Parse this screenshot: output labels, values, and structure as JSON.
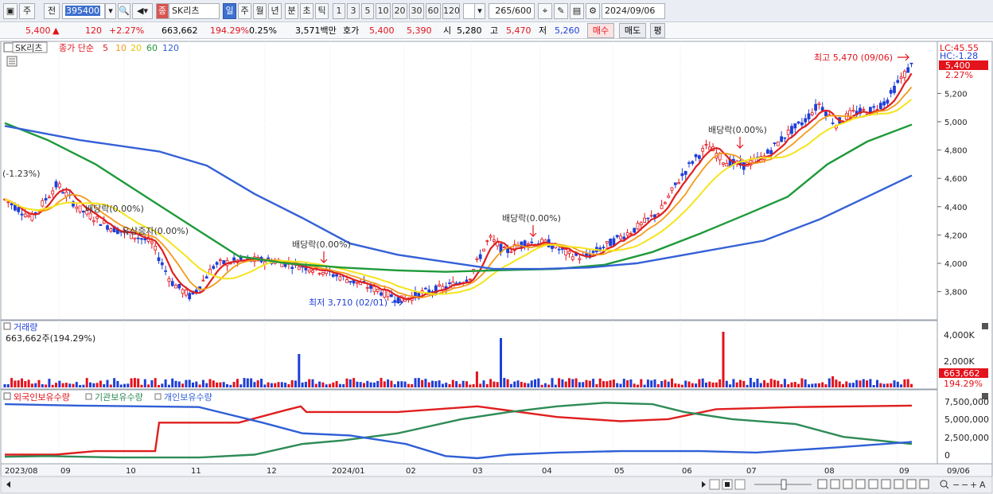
{
  "toolbar": {
    "mode": "주",
    "prev": "전",
    "code": "395400",
    "stock_badge": "종",
    "stock_name": "SK리츠",
    "periods": [
      "일",
      "주",
      "월",
      "년",
      "분",
      "초",
      "틱"
    ],
    "selected_period": "일",
    "intervals": [
      "1",
      "3",
      "5",
      "10",
      "20",
      "30",
      "60",
      "120"
    ],
    "count": "265",
    "count_total": "/600",
    "date": "2024/09/06"
  },
  "quote": {
    "price": "5,400",
    "change_arrow": "▲",
    "change": "120",
    "change_pct": "+2.27%",
    "volume": "663,662",
    "volume_ratio": "194.29%",
    "turnover": "0.25%",
    "amount": "3,571백만",
    "bid_label": "호가",
    "ask_price": "5,400",
    "bid_price": "5,390",
    "open_label": "시",
    "open": "5,280",
    "high_label": "고",
    "high": "5,470",
    "low_label": "저",
    "low": "5,260",
    "buy_btn": "매수",
    "sell_btn": "매도",
    "eval_btn": "평"
  },
  "price_panel": {
    "stock_tag": "SK리츠",
    "ma_title": "종가 단순",
    "ma_periods": [
      "5",
      "10",
      "20",
      "60",
      "120"
    ],
    "lc_label": "LC:45.55",
    "hc_label": "HC:-1.28",
    "current_price_tag": "5,400",
    "current_pct_tag": "2.27%",
    "y_ticks": [
      "5,200",
      "5,000",
      "4,800",
      "4,600",
      "4,400",
      "4,200",
      "4,000",
      "3,800"
    ],
    "annotations": {
      "high": "최고 5,470 (09/06)",
      "low": "최저 3,710 (02/01)",
      "left_pct": "(-1.23%)",
      "div1": "배당락(0.00%)",
      "rights": "유상증자(0.00%)",
      "div2": "배당락(0.00%)",
      "div3": "배당락(0.00%)",
      "div4": "배당락(0.00%)"
    }
  },
  "volume_panel": {
    "title": "거래량",
    "info": "663,662주(194.29%)",
    "y_ticks": [
      "4,000K",
      "2,000K"
    ],
    "current_tag": "663,662",
    "current_pct": "194.29%"
  },
  "holdings_panel": {
    "legend": [
      "외국인보유수량",
      "기관보유수량",
      "개인보유수량"
    ],
    "y_ticks": [
      "7,500,000",
      "5,000,000",
      "2,500,000",
      "0"
    ]
  },
  "x_axis": {
    "labels": [
      "2023/08",
      "09",
      "10",
      "11",
      "12",
      "2024/01",
      "02",
      "03",
      "04",
      "05",
      "06",
      "07",
      "08",
      "09",
      "09/06"
    ]
  },
  "colors": {
    "up": "#e3121b",
    "down": "#1f3fd6",
    "ma5": "#e01f1f",
    "ma10": "#f39a1b",
    "ma20": "#f5e41c",
    "ma60": "#1f9a3a",
    "ma120": "#3461d6",
    "foreign": "#e01f1f",
    "institution": "#2e8b57",
    "individual": "#2f5fd6"
  },
  "chart_data": {
    "type": "line",
    "x": [
      "2023/08",
      "09",
      "10",
      "11",
      "12",
      "2024/01",
      "02",
      "03",
      "04",
      "05",
      "06",
      "07",
      "08",
      "09",
      "09/06"
    ],
    "series": [],
    "y_range": [
      3700,
      5470
    ],
    "annotations": [
      "최고 5,470 (09/06)",
      "최저 3,710 (02/01)"
    ]
  }
}
